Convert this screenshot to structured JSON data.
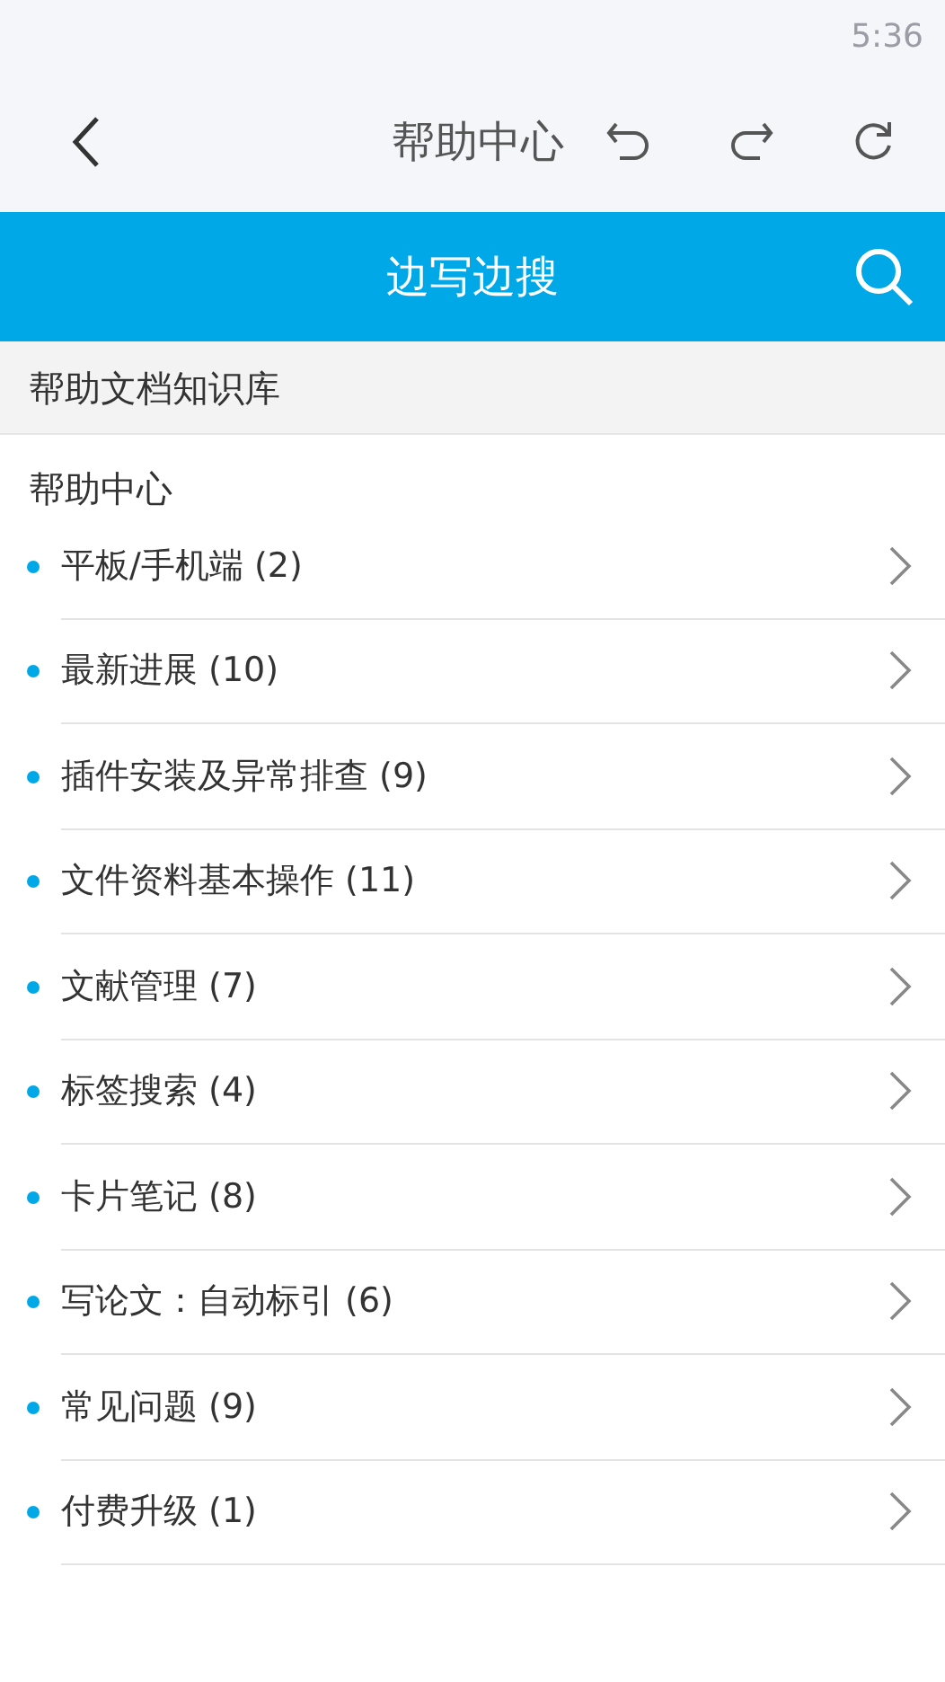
{
  "status_bar": {
    "time": "5:36"
  },
  "toolbar": {
    "title": "帮助中心"
  },
  "search_bar": {
    "title": "边写边搜"
  },
  "section_header": "帮助文档知识库",
  "group_title": "帮助中心",
  "items": [
    {
      "label": "平板/手机端 (2)"
    },
    {
      "label": "最新进展 (10)"
    },
    {
      "label": "插件安装及异常排查 (9)"
    },
    {
      "label": "文件资料基本操作 (11)"
    },
    {
      "label": "文献管理 (7)"
    },
    {
      "label": "标签搜索 (4)"
    },
    {
      "label": "卡片笔记 (8)"
    },
    {
      "label": "写论文：自动标引 (6)"
    },
    {
      "label": "常见问题 (9)"
    },
    {
      "label": "付费升级 (1)"
    }
  ]
}
